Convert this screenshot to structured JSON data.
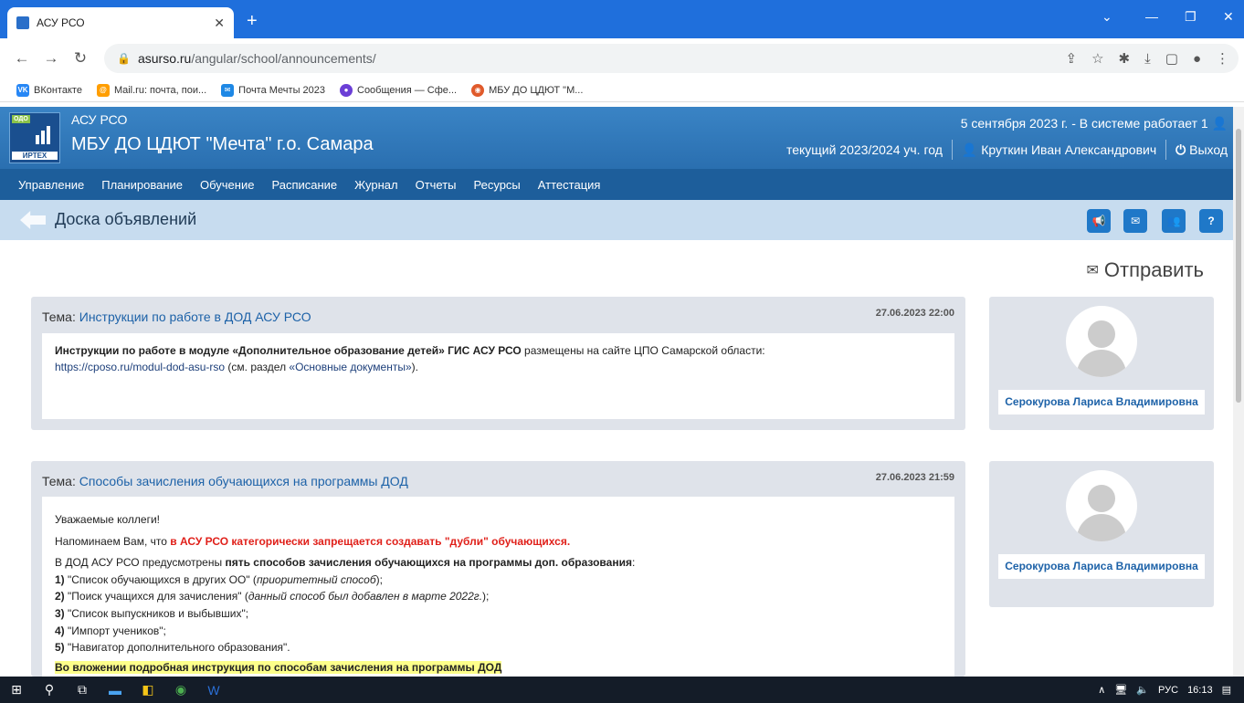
{
  "browser": {
    "tab_title": "АСУ РСО",
    "url_host": "asurso.ru",
    "url_path": "/angular/school/announcements/",
    "bookmarks": [
      {
        "label": "ВКонтакте",
        "color": "#2787f5",
        "glyph": "VK"
      },
      {
        "label": "Mail.ru: почта, пои...",
        "color": "#ff9e00",
        "glyph": "@"
      },
      {
        "label": "Почта Мечты 2023",
        "color": "#1e88e5",
        "glyph": "✉"
      },
      {
        "label": "Сообщения — Сфе...",
        "color": "#6b3fd6",
        "glyph": "●"
      },
      {
        "label": "МБУ ДО ЦДЮТ \"М...",
        "color": "#e05a2b",
        "glyph": "◉"
      }
    ]
  },
  "header": {
    "app_name": "АСУ РСО",
    "org_name": "МБУ ДО ЦДЮТ \"Мечта\" г.о. Самара",
    "logo_badge": "ОДО",
    "logo_brand": "ИРТЕХ",
    "status": "5 сентября 2023 г. - В системе работает 1",
    "year": "текущий 2023/2024 уч. год",
    "user": "Круткин Иван Александрович",
    "logout": "Выход"
  },
  "menu": [
    "Управление",
    "Планирование",
    "Обучение",
    "Расписание",
    "Журнал",
    "Отчеты",
    "Ресурсы",
    "Аттестация"
  ],
  "page": {
    "title": "Доска объявлений",
    "send": "Отправить",
    "help": "?"
  },
  "announcements": [
    {
      "subject_label": "Тема:",
      "subject": "Инструкции по работе в ДОД АСУ РСО",
      "date": "27.06.2023 22:00",
      "author": "Серокурова Лариса Владимировна",
      "b1_bold": "Инструкции по работе в модуле «Дополнительное образование детей» ГИС АСУ РСО",
      "b1_text": " размещены на сайте ЦПО Самарской области:",
      "b1_link": "https://cposo.ru/modul-dod-asu-rso",
      "b1_mid": " (см. раздел ",
      "b1_link2": "«Основные документы»",
      "b1_end": ")."
    },
    {
      "subject_label": "Тема:",
      "subject": "Способы зачисления обучающихся на программы ДОД",
      "date": "27.06.2023 21:59",
      "author": "Серокурова Лариса Владимировна",
      "greeting": "Уважаемые коллеги!",
      "remind": "Напоминаем Вам, что ",
      "remind_red": "в АСУ РСО категорически запрещается создавать \"дубли\" обучающихся.",
      "intro": "В ДОД АСУ РСО предусмотрены ",
      "intro_bold": "пять способов зачисления обучающихся на программы доп. образования",
      "intro_end": ":",
      "items": [
        {
          "n": "1)",
          "t": " \"Список обучающихся в других ОО\" (",
          "i": "приоритетный способ",
          "e": ");"
        },
        {
          "n": "2)",
          "t": " \"Поиск учащихся для зачисления\" (",
          "i": "данный способ был добавлен в марте 2022г.",
          "e": ");"
        },
        {
          "n": "3)",
          "t": " \"Список выпускников и выбывших\";",
          "i": "",
          "e": ""
        },
        {
          "n": "4)",
          "t": " \"Импорт учеников\";",
          "i": "",
          "e": ""
        },
        {
          "n": "5)",
          "t": " \"Навигатор дополнительного образования\".",
          "i": "",
          "e": ""
        }
      ],
      "attachment": "Во вложении подробная инструкция по способам зачисления на программы ДОД"
    }
  ],
  "taskbar": {
    "lang": "РУС",
    "time": "16:13"
  }
}
